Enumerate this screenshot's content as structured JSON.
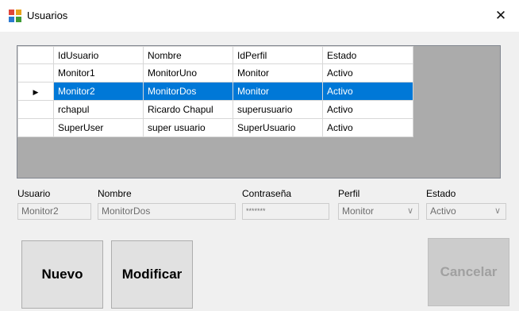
{
  "window": {
    "title": "Usuarios",
    "close_glyph": "✕"
  },
  "grid": {
    "columns": [
      "IdUsuario",
      "Nombre",
      "IdPerfil",
      "Estado"
    ],
    "rows": [
      {
        "selected": false,
        "cells": [
          "Monitor1",
          "MonitorUno",
          "Monitor",
          "Activo"
        ]
      },
      {
        "selected": true,
        "cells": [
          "Monitor2",
          "MonitorDos",
          "Monitor",
          "Activo"
        ]
      },
      {
        "selected": false,
        "cells": [
          "rchapul",
          "Ricardo Chapul",
          "superusuario",
          "Activo"
        ]
      },
      {
        "selected": false,
        "cells": [
          "SuperUser",
          "super usuario",
          "SuperUsuario",
          "Activo"
        ]
      }
    ],
    "selection_color": "#0078d7"
  },
  "form": {
    "usuario": {
      "label": "Usuario",
      "value": "Monitor2"
    },
    "nombre": {
      "label": "Nombre",
      "value": "MonitorDos"
    },
    "contrasena": {
      "label": "Contraseña",
      "value": "*******"
    },
    "perfil": {
      "label": "Perfil",
      "value": "Monitor"
    },
    "estado": {
      "label": "Estado",
      "value": "Activo"
    }
  },
  "buttons": {
    "nuevo": "Nuevo",
    "modificar": "Modificar",
    "cancelar": "Cancelar"
  }
}
